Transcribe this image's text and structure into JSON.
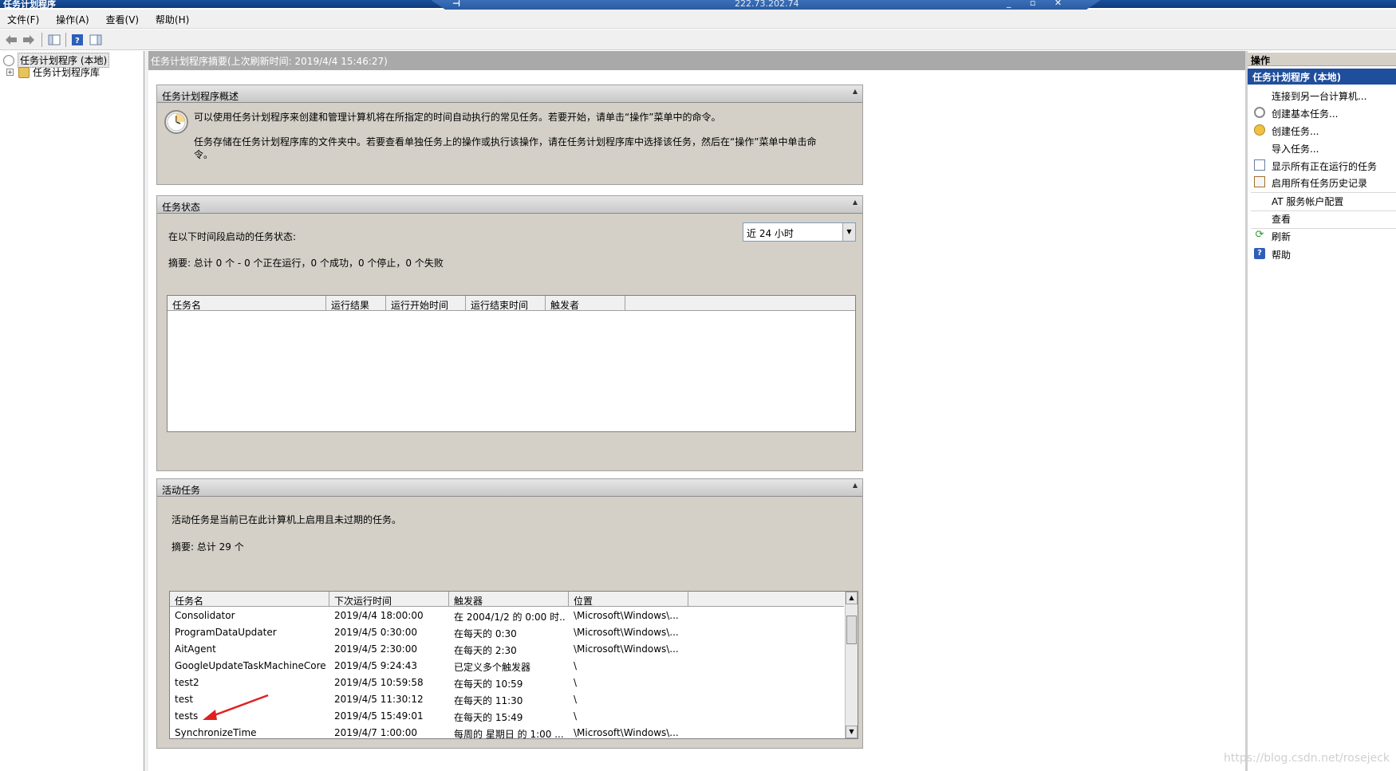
{
  "window": {
    "title": "任务计划程序"
  },
  "rdp": {
    "ip": "222.73.202.74",
    "controls": "_ ▫ ✕",
    "pin": "⊣"
  },
  "menu": {
    "items": [
      "文件(F)",
      "操作(A)",
      "查看(V)",
      "帮助(H)"
    ]
  },
  "tree": {
    "root_label": "任务计划程序 (本地)",
    "child_label": "任务计划程序库"
  },
  "center": {
    "header": "任务计划程序摘要(上次刷新时间: 2019/4/4 15:46:27)",
    "overview": {
      "title": "任务计划程序概述",
      "line1": "可以使用任务计划程序来创建和管理计算机将在所指定的时间自动执行的常见任务。若要开始，请单击“操作”菜单中的命令。",
      "line2": "任务存储在任务计划程序库的文件夹中。若要查看单独任务上的操作或执行该操作，请在任务计划程序库中选择该任务，然后在“操作”菜单中单击命",
      "line3": "令。"
    },
    "status": {
      "title": "任务状态",
      "prompt": "在以下时间段启动的任务状态:",
      "range_value": "近 24 小时",
      "summary": "摘要: 总计 0 个 - 0 个正在运行，0 个成功，0 个停止，0 个失败",
      "columns": [
        "任务名",
        "运行结果",
        "运行开始时间",
        "运行结束时间",
        "触发者"
      ]
    },
    "active": {
      "title": "活动任务",
      "desc": "活动任务是当前已在此计算机上启用且未过期的任务。",
      "summary": "摘要: 总计 29 个",
      "columns": [
        "任务名",
        "下次运行时间",
        "触发器",
        "位置"
      ],
      "rows": [
        [
          "Consolidator",
          "2019/4/4 18:00:00",
          "在 2004/1/2 的 0:00 时...",
          "\\Microsoft\\Windows\\..."
        ],
        [
          "ProgramDataUpdater",
          "2019/4/5 0:30:00",
          "在每天的 0:30",
          "\\Microsoft\\Windows\\..."
        ],
        [
          "AitAgent",
          "2019/4/5 2:30:00",
          "在每天的 2:30",
          "\\Microsoft\\Windows\\..."
        ],
        [
          "GoogleUpdateTaskMachineCore",
          "2019/4/5 9:24:43",
          "已定义多个触发器",
          "\\"
        ],
        [
          "test2",
          "2019/4/5 10:59:58",
          "在每天的 10:59",
          "\\"
        ],
        [
          "test",
          "2019/4/5 11:30:12",
          "在每天的 11:30",
          "\\"
        ],
        [
          "tests",
          "2019/4/5 15:49:01",
          "在每天的 15:49",
          "\\"
        ],
        [
          "SynchronizeTime",
          "2019/4/7 1:00:00",
          "每周的 星期日 的 1:00 ...",
          "\\Microsoft\\Windows\\..."
        ]
      ]
    }
  },
  "actions": {
    "title": "操作",
    "subtitle": "任务计划程序 (本地)",
    "items": [
      {
        "label": "连接到另一台计算机...",
        "icon": "none"
      },
      {
        "label": "创建基本任务...",
        "icon": "basic-task-icon"
      },
      {
        "label": "创建任务...",
        "icon": "create-task-icon"
      },
      {
        "label": "导入任务...",
        "icon": "none"
      },
      {
        "label": "显示所有正在运行的任务",
        "icon": "running-tasks-icon"
      },
      {
        "label": "启用所有任务历史记录",
        "icon": "history-icon"
      },
      {
        "label": "AT 服务帐户配置",
        "icon": "none"
      },
      {
        "label": "查看",
        "icon": "none"
      },
      {
        "label": "刷新",
        "icon": "refresh-icon"
      },
      {
        "label": "帮助",
        "icon": "help-icon"
      }
    ]
  },
  "watermark": "https://blog.csdn.net/rosejeck"
}
